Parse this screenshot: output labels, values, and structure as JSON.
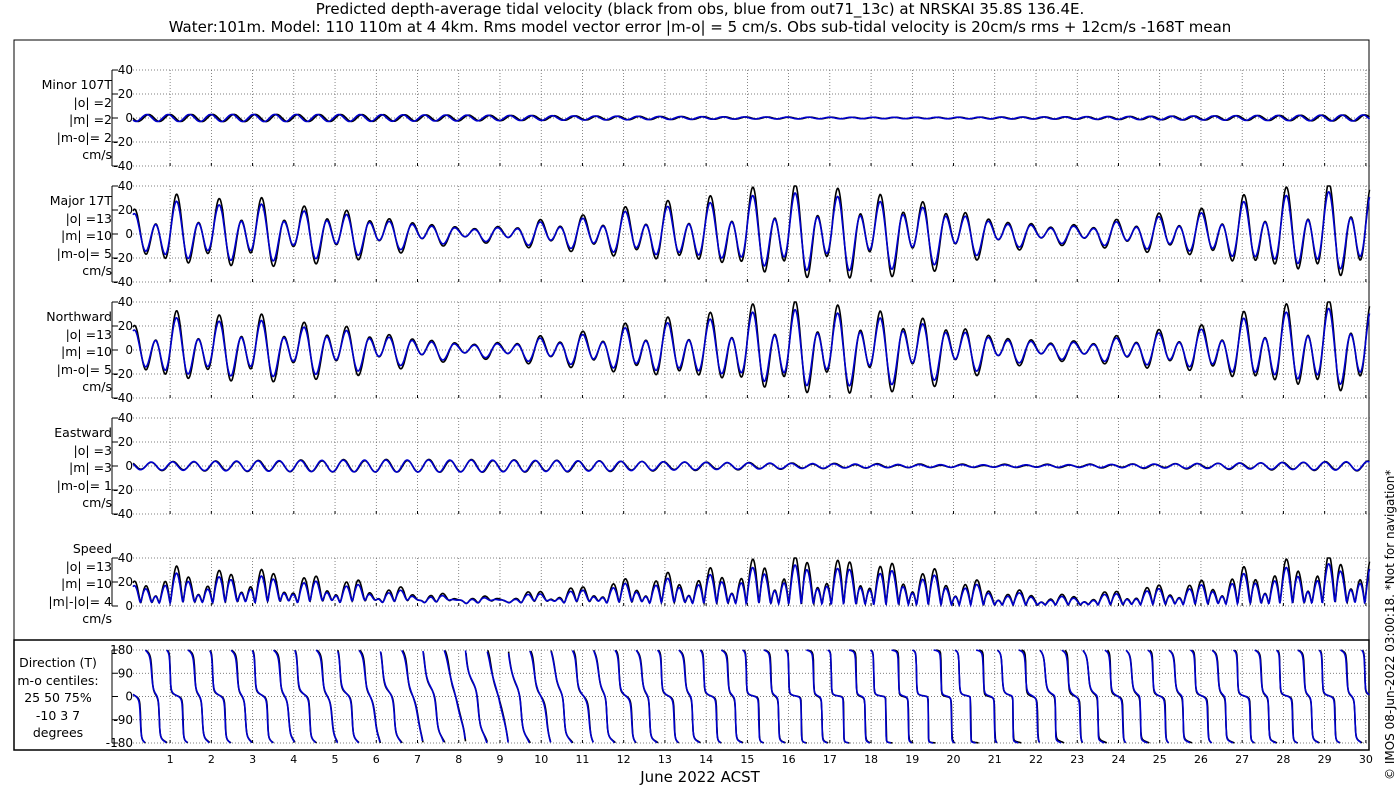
{
  "title_line1": "Predicted depth-average tidal velocity (black from obs, blue from out71_13c) at NRSKAI 35.8S 136.4E.",
  "title_line2": "Water:101m. Model: 110 110m at 4 4km. Rms model vector error |m-o| = 5 cm/s. Obs sub-tidal velocity is 20cm/s rms + 12cm/s -168T mean",
  "copyright": "© IMOS 08-Jun-2022 03:00:18. *Not for navigation*",
  "x_axis_label": "June 2022 ACST",
  "colors": {
    "obs": "#000000",
    "model": "#0000cc",
    "grid": "#555555"
  },
  "panels": [
    {
      "id": "minor",
      "labels": [
        "Minor 107T",
        "|o| =2",
        "|m| =2",
        "|m-o|= 2",
        "cm/s"
      ]
    },
    {
      "id": "major",
      "labels": [
        "Major 17T",
        "|o| =13",
        "|m| =10",
        "|m-o|= 5",
        "cm/s"
      ]
    },
    {
      "id": "north",
      "labels": [
        "Northward",
        "|o| =13",
        "|m| =10",
        "|m-o|= 5",
        "cm/s"
      ]
    },
    {
      "id": "east",
      "labels": [
        "Eastward",
        "|o| =3",
        "|m| =3",
        "|m-o|= 1",
        "cm/s"
      ]
    },
    {
      "id": "speed",
      "labels": [
        "Speed",
        "|o| =13",
        "|m| =10",
        "|m|-|o|= 4",
        "cm/s"
      ]
    },
    {
      "id": "direction",
      "labels": [
        "Direction (T)",
        "m-o centiles:",
        "25  50  75%",
        "-10   3   7",
        "degrees"
      ]
    }
  ],
  "chart_data": [
    {
      "type": "line",
      "title": "Minor 107T",
      "x_ticks": [
        "1",
        "2",
        "3",
        "4",
        "5",
        "6",
        "7",
        "8",
        "9",
        "10",
        "11",
        "12",
        "13",
        "14",
        "15",
        "16",
        "17",
        "18",
        "19",
        "20",
        "21",
        "22",
        "23",
        "24",
        "25",
        "26",
        "27",
        "28",
        "29",
        "30"
      ],
      "y_ticks": [
        "40",
        "20",
        "0",
        "-20",
        "-40"
      ],
      "ylim": [
        -40,
        40
      ],
      "series": [
        {
          "name": "obs",
          "amplitude_envelope_peak": 2
        },
        {
          "name": "out71_13c",
          "amplitude_envelope_peak": 2
        }
      ]
    },
    {
      "type": "line",
      "title": "Major 17T",
      "x_ticks": [
        "1",
        "2",
        "3",
        "4",
        "5",
        "6",
        "7",
        "8",
        "9",
        "10",
        "11",
        "12",
        "13",
        "14",
        "15",
        "16",
        "17",
        "18",
        "19",
        "20",
        "21",
        "22",
        "23",
        "24",
        "25",
        "26",
        "27",
        "28",
        "29",
        "30"
      ],
      "y_ticks": [
        "40",
        "20",
        "0",
        "-20",
        "-40"
      ],
      "ylim": [
        -40,
        40
      ]
    },
    {
      "type": "line",
      "title": "Northward",
      "x_ticks": [
        "1",
        "2",
        "3",
        "4",
        "5",
        "6",
        "7",
        "8",
        "9",
        "10",
        "11",
        "12",
        "13",
        "14",
        "15",
        "16",
        "17",
        "18",
        "19",
        "20",
        "21",
        "22",
        "23",
        "24",
        "25",
        "26",
        "27",
        "28",
        "29",
        "30"
      ],
      "y_ticks": [
        "40",
        "20",
        "0",
        "-20",
        "-40"
      ],
      "ylim": [
        -40,
        40
      ]
    },
    {
      "type": "line",
      "title": "Eastward",
      "x_ticks": [
        "1",
        "2",
        "3",
        "4",
        "5",
        "6",
        "7",
        "8",
        "9",
        "10",
        "11",
        "12",
        "13",
        "14",
        "15",
        "16",
        "17",
        "18",
        "19",
        "20",
        "21",
        "22",
        "23",
        "24",
        "25",
        "26",
        "27",
        "28",
        "29",
        "30"
      ],
      "y_ticks": [
        "40",
        "20",
        "0",
        "-20",
        "-40"
      ],
      "ylim": [
        -40,
        40
      ]
    },
    {
      "type": "line",
      "title": "Speed",
      "x_ticks": [
        "1",
        "2",
        "3",
        "4",
        "5",
        "6",
        "7",
        "8",
        "9",
        "10",
        "11",
        "12",
        "13",
        "14",
        "15",
        "16",
        "17",
        "18",
        "19",
        "20",
        "21",
        "22",
        "23",
        "24",
        "25",
        "26",
        "27",
        "28",
        "29",
        "30"
      ],
      "y_ticks": [
        "40",
        "20",
        "0"
      ],
      "ylim": [
        0,
        40
      ]
    },
    {
      "type": "line",
      "title": "Direction (T)",
      "x_ticks": [
        "1",
        "2",
        "3",
        "4",
        "5",
        "6",
        "7",
        "8",
        "9",
        "10",
        "11",
        "12",
        "13",
        "14",
        "15",
        "16",
        "17",
        "18",
        "19",
        "20",
        "21",
        "22",
        "23",
        "24",
        "25",
        "26",
        "27",
        "28",
        "29",
        "30"
      ],
      "y_ticks": [
        "180",
        "90",
        "0",
        "-90",
        "-180"
      ],
      "ylim": [
        -180,
        180
      ]
    }
  ],
  "signal_model": {
    "x_range_days": [
      0.1,
      30.1
    ],
    "m2_period_days": 0.5175,
    "k1_period_days": 0.9973,
    "amp_major_obs": [
      12,
      22,
      19,
      22,
      17,
      17,
      12,
      9,
      5,
      5,
      9,
      11,
      15,
      18,
      20,
      25,
      28,
      27,
      25,
      23,
      18,
      11,
      7,
      6,
      9,
      12,
      14,
      21,
      25,
      28,
      28
    ],
    "amp_east_obs": 5,
    "amp_minor_obs": 3
  }
}
